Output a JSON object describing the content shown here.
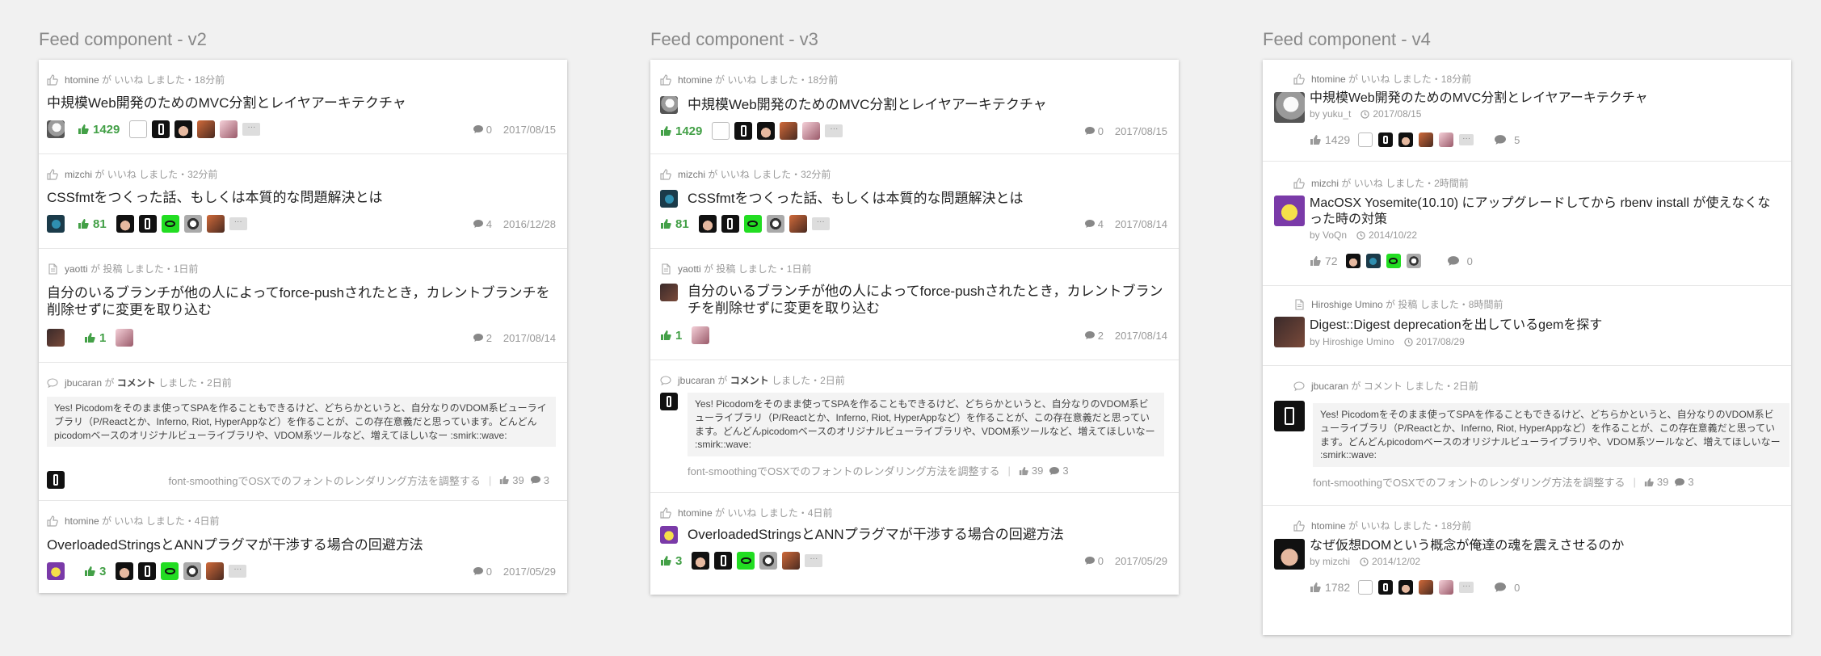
{
  "columns": [
    {
      "title": "Feed component - v2",
      "items": [
        {
          "kind": "like",
          "user": "htomine",
          "verb": "いいね",
          "time": "しました・18分前",
          "title": "中規模Web開発のためのMVC分割とレイヤアーキテクチャ",
          "likes": "1429",
          "comments": "0",
          "date": "2017/08/15"
        },
        {
          "kind": "like",
          "user": "mizchi",
          "verb": "いいね",
          "time": "しました・32分前",
          "title": "CSSfmtをつくった話、もしくは本質的な問題解決とは",
          "likes": "81",
          "comments": "4",
          "date": "2016/12/28"
        },
        {
          "kind": "post",
          "user": "yaotti",
          "verb": "投稿",
          "time": "しました・1日前",
          "title": "自分のいるブランチが他の人によってforce-pushされたとき，カレントブランチを削除せずに変更を取り込む",
          "likes": "1",
          "comments": "2",
          "date": "2017/08/14"
        },
        {
          "kind": "comment",
          "user": "jbucaran",
          "verb": "コメント",
          "time": "しました・2日前",
          "quote": "Yes! Picodomをそのまま使ってSPAを作ることもできるけど、どちらかというと、自分なりのVDOM系ビューライブラリ（P/Reactとか、Inferno, Riot, HyperAppなど）を作ることが、この存在意義だと思っています。どんどんpicodomベースのオリジナルビューライブラリや、VDOM系ツールなど、増えてほしいなー :smirk::wave:",
          "ref": "font-smoothingでOSXでのフォントのレンダリング方法を調整する",
          "ref_likes": "39",
          "ref_comments": "3"
        },
        {
          "kind": "like",
          "user": "htomine",
          "verb": "いいね",
          "time": "しました・4日前",
          "title": "OverloadedStringsとANNプラグマが干渉する場合の回避方法",
          "likes": "3",
          "comments": "0",
          "date": "2017/05/29"
        }
      ]
    },
    {
      "title": "Feed component - v3",
      "items": [
        {
          "kind": "like",
          "user": "htomine",
          "verb": "いいね",
          "time": "しました・18分前",
          "title": "中規模Web開発のためのMVC分割とレイヤアーキテクチャ",
          "likes": "1429",
          "comments": "0",
          "date": "2017/08/15"
        },
        {
          "kind": "like",
          "user": "mizchi",
          "verb": "いいね",
          "time": "しました・32分前",
          "title": "CSSfmtをつくった話、もしくは本質的な問題解決とは",
          "likes": "81",
          "comments": "4",
          "date": "2017/08/14"
        },
        {
          "kind": "post",
          "user": "yaotti",
          "verb": "投稿",
          "time": "しました・1日前",
          "title": "自分のいるブランチが他の人によってforce-pushされたとき，カレントブランチを削除せずに変更を取り込む",
          "likes": "1",
          "comments": "2",
          "date": "2017/08/14"
        },
        {
          "kind": "comment",
          "user": "jbucaran",
          "verb": "コメント",
          "time": "しました・2日前",
          "quote": "Yes! Picodomをそのまま使ってSPAを作ることもできるけど、どちらかというと、自分なりのVDOM系ビューライブラリ（P/Reactとか、Inferno, Riot, HyperAppなど）を作ることが、この存在意義だと思っています。どんどんpicodomベースのオリジナルビューライブラリや、VDOM系ツールなど、増えてほしいなー :smirk::wave:",
          "ref": "font-smoothingでOSXでのフォントのレンダリング方法を調整する",
          "ref_likes": "39",
          "ref_comments": "3"
        },
        {
          "kind": "like",
          "user": "htomine",
          "verb": "いいね",
          "time": "しました・4日前",
          "title": "OverloadedStringsとANNプラグマが干渉する場合の回避方法",
          "likes": "3",
          "comments": "0",
          "date": "2017/05/29"
        }
      ]
    },
    {
      "title": "Feed component - v4",
      "items": [
        {
          "kind": "like",
          "user": "htomine",
          "verb": "いいね",
          "time": "しました・18分前",
          "title": "中規模Web開発のためのMVC分割とレイヤアーキテクチャ",
          "author": "by yuku_t",
          "date": "2017/08/15",
          "likes": "1429",
          "comments": "5"
        },
        {
          "kind": "like",
          "user": "mizchi",
          "verb": "いいね",
          "time": "しました・2時間前",
          "title": "MacOSX Yosemite(10.10) にアップグレードしてから rbenv install が使えなくなった時の対策",
          "author": "by VoQn",
          "date": "2014/10/22",
          "likes": "72",
          "comments": "0"
        },
        {
          "kind": "post",
          "user": "Hiroshige Umino",
          "verb": "投稿",
          "time": "しました・8時間前",
          "title": "Digest::Digest deprecationを出しているgemを探す",
          "author": "by Hiroshige Umino",
          "date": "2017/08/29"
        },
        {
          "kind": "comment",
          "user": "jbucaran",
          "verb": "コメント",
          "time": "しました・2日前",
          "quote": "Yes! Picodomをそのまま使ってSPAを作ることもできるけど、どちらかというと、自分なりのVDOM系ビューライブラリ（P/Reactとか、Inferno, Riot, HyperAppなど）を作ることが、この存在意義だと思っています。どんどんpicodomベースのオリジナルビューライブラリや、VDOM系ツールなど、増えてほしいなー :smirk::wave:",
          "ref": "font-smoothingでOSXでのフォントのレンダリング方法を調整する",
          "ref_likes": "39",
          "ref_comments": "3"
        },
        {
          "kind": "like",
          "user": "htomine",
          "verb": "いいね",
          "time": "しました・18分前",
          "title": "なぜ仮想DOMという概念が俺達の魂を震えさせるのか",
          "author": "by mizchi",
          "date": "2014/12/02",
          "likes": "1782",
          "comments": "0"
        }
      ]
    }
  ],
  "labels": {
    "ga": "が",
    "more": "···"
  },
  "colors": {
    "accent_green": "#43a047",
    "muted": "#999999"
  }
}
